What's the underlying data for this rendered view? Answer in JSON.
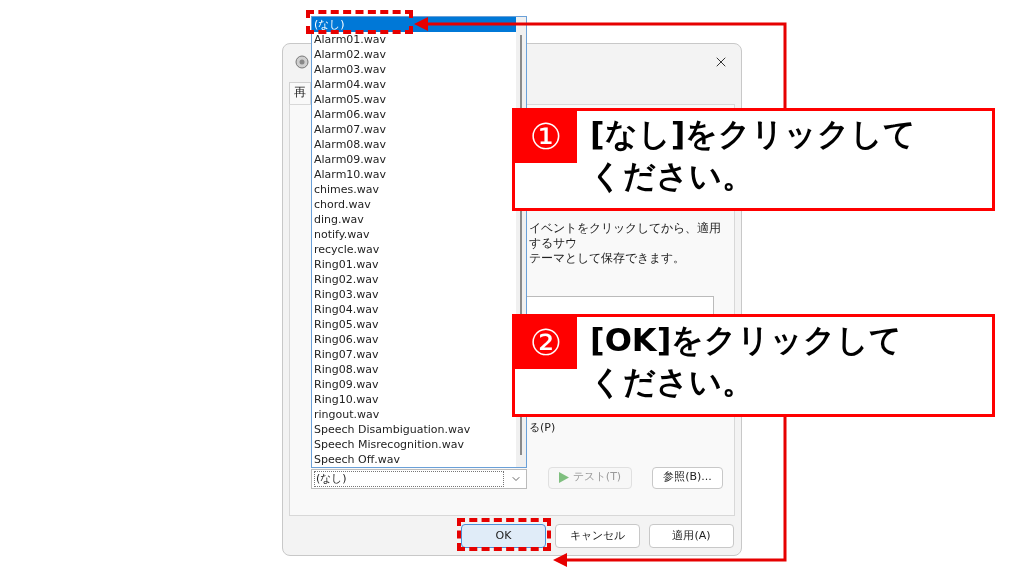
{
  "dialog": {
    "tab": "再",
    "panel_text": [
      "イベントをクリックしてから、適用するサウ",
      "テーマとして保存できます。"
    ],
    "checkbox_label": "る(P)",
    "test_button": {
      "label": "テスト(T)",
      "disabled": true
    },
    "browse_button": {
      "label": "参照(B)...",
      "disabled": false
    },
    "footer_buttons": [
      {
        "label": "OK",
        "default": true
      },
      {
        "label": "キャンセル",
        "default": false
      },
      {
        "label": "適用(A)",
        "default": false
      }
    ]
  },
  "dropdown": {
    "value": "(なし)",
    "items": [
      {
        "label": "(なし)",
        "selected": true
      },
      {
        "label": "Alarm01.wav",
        "selected": false
      },
      {
        "label": "Alarm02.wav",
        "selected": false
      },
      {
        "label": "Alarm03.wav",
        "selected": false
      },
      {
        "label": "Alarm04.wav",
        "selected": false
      },
      {
        "label": "Alarm05.wav",
        "selected": false
      },
      {
        "label": "Alarm06.wav",
        "selected": false
      },
      {
        "label": "Alarm07.wav",
        "selected": false
      },
      {
        "label": "Alarm08.wav",
        "selected": false
      },
      {
        "label": "Alarm09.wav",
        "selected": false
      },
      {
        "label": "Alarm10.wav",
        "selected": false
      },
      {
        "label": "chimes.wav",
        "selected": false
      },
      {
        "label": "chord.wav",
        "selected": false
      },
      {
        "label": "ding.wav",
        "selected": false
      },
      {
        "label": "notify.wav",
        "selected": false
      },
      {
        "label": "recycle.wav",
        "selected": false
      },
      {
        "label": "Ring01.wav",
        "selected": false
      },
      {
        "label": "Ring02.wav",
        "selected": false
      },
      {
        "label": "Ring03.wav",
        "selected": false
      },
      {
        "label": "Ring04.wav",
        "selected": false
      },
      {
        "label": "Ring05.wav",
        "selected": false
      },
      {
        "label": "Ring06.wav",
        "selected": false
      },
      {
        "label": "Ring07.wav",
        "selected": false
      },
      {
        "label": "Ring08.wav",
        "selected": false
      },
      {
        "label": "Ring09.wav",
        "selected": false
      },
      {
        "label": "Ring10.wav",
        "selected": false
      },
      {
        "label": "ringout.wav",
        "selected": false
      },
      {
        "label": "Speech Disambiguation.wav",
        "selected": false
      },
      {
        "label": "Speech Misrecognition.wav",
        "selected": false
      },
      {
        "label": "Speech Off.wav",
        "selected": false
      }
    ]
  },
  "callouts": [
    {
      "number": "①",
      "lines": [
        "[なし]をクリックして",
        "ください。"
      ]
    },
    {
      "number": "②",
      "lines": [
        "[OK]をクリックして",
        "ください。"
      ]
    }
  ]
}
